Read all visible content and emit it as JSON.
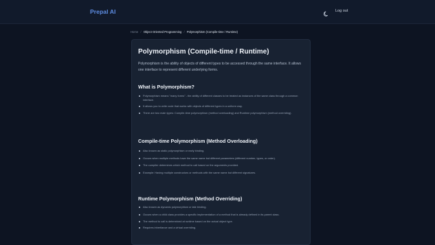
{
  "header": {
    "brand": "Prepal AI",
    "theme_icon": "moon-icon",
    "logout_label": "Log out"
  },
  "breadcrumb": {
    "home": "Home",
    "category": "Object Oriented Programming",
    "current": "Polymorphism (Compile-time / Runtime)"
  },
  "article": {
    "title": "Polymorphism (Compile-time / Runtime)",
    "intro": "Polymorphism is the ability of objects of different types to be accessed through the same interface. It allows one interface to represent different underlying forms.",
    "sections": [
      {
        "heading": "What is Polymorphism?",
        "items": [
          "Polymorphism means \"many forms\" - the ability of different classes to be treated as instances of the same class through a common interface.",
          "It allows you to write code that works with objects of different types in a uniform way.",
          "There are two main types: Compile-time polymorphism (method overloading) and Runtime polymorphism (method overriding)."
        ]
      },
      {
        "heading": "Compile-time Polymorphism (Method Overloading)",
        "items": [
          "Also known as static polymorphism or early binding.",
          "Occurs when multiple methods have the same name but different parameters (different number, types, or order).",
          "The compiler determines which method to call based on the arguments provided.",
          "Example: Having multiple constructors or methods with the same name but different signatures."
        ]
      },
      {
        "heading": "Runtime Polymorphism (Method Overriding)",
        "items": [
          "Also known as dynamic polymorphism or late binding.",
          "Occurs when a child class provides a specific implementation of a method that is already defined in its parent class.",
          "The method to call is determined at runtime based on the actual object type.",
          "Requires inheritance and a virtual overriding."
        ]
      }
    ]
  }
}
